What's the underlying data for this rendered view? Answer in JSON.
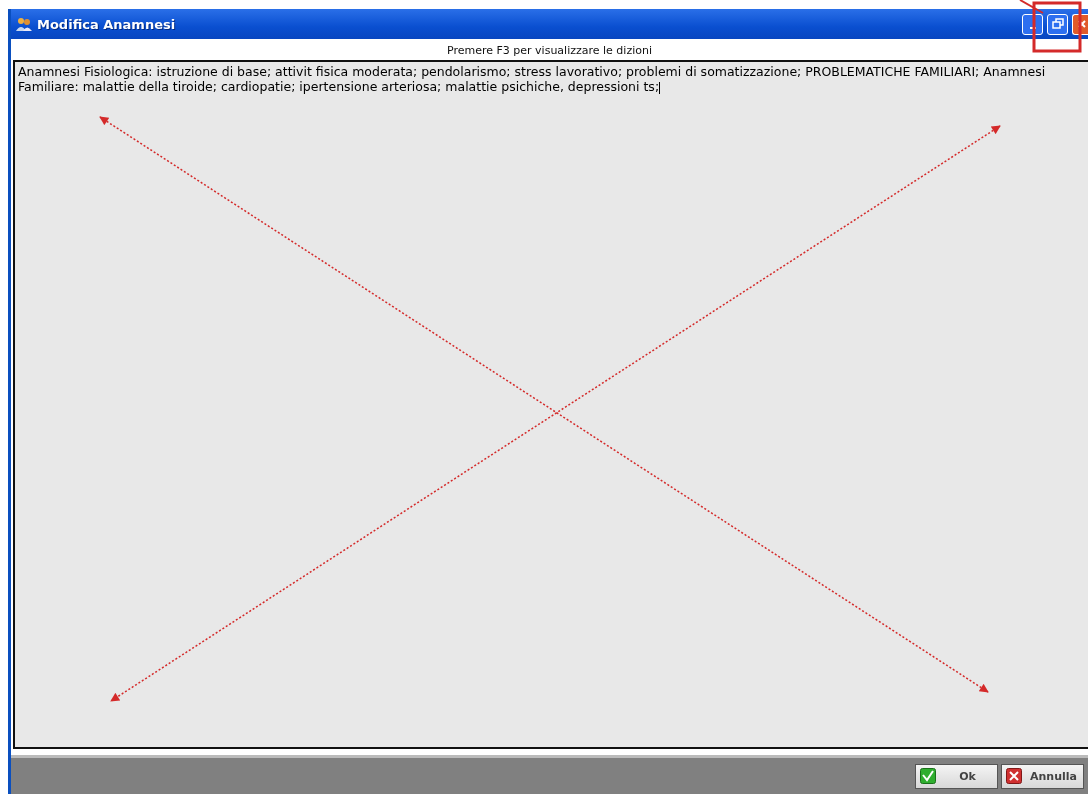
{
  "window": {
    "title": "Modifica Anamnesi"
  },
  "hint": "Premere F3 per visualizzare le dizioni",
  "text_area": {
    "value": "Anamnesi Fisiologica: istruzione di base; attivit  fisica moderata; pendolarismo; stress lavorativo; problemi di somatizzazione; PROBLEMATICHE FAMILIARI; Anamnesi Familiare: malattie della tiroide; cardiopatie; ipertensione arteriosa; malattie psichiche, depressioni ts;"
  },
  "buttons": [
    {
      "label": "Ok",
      "kind": "ok"
    },
    {
      "label": "Annulla",
      "kind": "cancel"
    }
  ]
}
